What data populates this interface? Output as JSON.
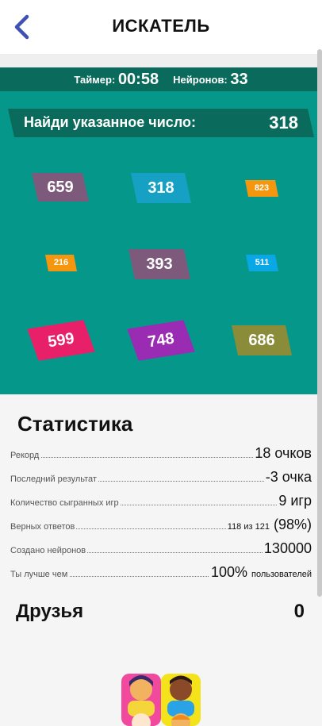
{
  "header": {
    "title": "ИСКАТЕЛЬ",
    "back_icon": "chevron-left-icon"
  },
  "status": {
    "timer_label": "Таймер:",
    "timer_value": "00:58",
    "neurons_label": "Нейронов:",
    "neurons_value": "33"
  },
  "game": {
    "prompt": "Найди указанное число:",
    "target": "318",
    "tiles": [
      {
        "value": "659",
        "color": "#7d5a7b"
      },
      {
        "value": "318",
        "color": "#16a1c4"
      },
      {
        "value": "823",
        "color": "#f5960f"
      },
      {
        "value": "216",
        "color": "#f5960f"
      },
      {
        "value": "393",
        "color": "#7d5a7b"
      },
      {
        "value": "511",
        "color": "#0aa7e6"
      },
      {
        "value": "599",
        "color": "#e8206a"
      },
      {
        "value": "748",
        "color": "#9a2bb3"
      },
      {
        "value": "686",
        "color": "#8a8c3a"
      }
    ]
  },
  "stats": {
    "title": "Статистика",
    "rows": [
      {
        "label": "Рекорд",
        "value": "18 очков",
        "suffix": ""
      },
      {
        "label": "Последний результат",
        "value": "-3 очка",
        "suffix": ""
      },
      {
        "label": "Количество сыгранных игр",
        "value": "9 игр",
        "suffix": ""
      },
      {
        "label": "Верных ответов",
        "value_prefix": "118 из 121",
        "value": "(98%)",
        "suffix": ""
      },
      {
        "label": "Создано нейронов",
        "value": "130000",
        "suffix": ""
      },
      {
        "label": "Ты лучше чем",
        "value": "100%",
        "suffix": "пользователей"
      }
    ]
  },
  "friends": {
    "title": "Друзья",
    "count": "0",
    "illustration": "friends-avatars-icon"
  },
  "colors": {
    "status_bar": "#0a6b5c",
    "game_bg": "#05988a",
    "target_banner": "#0a6b5c",
    "back_arrow": "#3f51b5"
  }
}
